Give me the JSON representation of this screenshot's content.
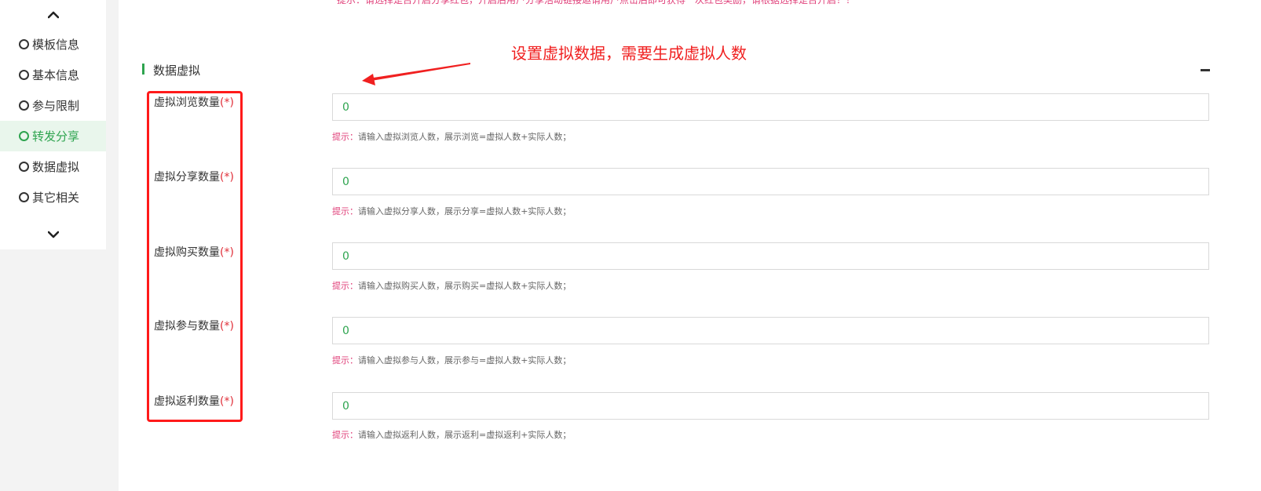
{
  "sidebar": {
    "items": [
      {
        "label": "模板信息",
        "active": false
      },
      {
        "label": "基本信息",
        "active": false
      },
      {
        "label": "参与限制",
        "active": false
      },
      {
        "label": "转发分享",
        "active": true
      },
      {
        "label": "数据虚拟",
        "active": false
      },
      {
        "label": "其它相关",
        "active": false
      }
    ],
    "up_icon": "chevron-up-icon",
    "down_icon": "chevron-down-icon"
  },
  "main": {
    "top_hint": "提示：请选择是否开启分享红包，开启后用户分享活动链接邀请用户点击后即可获得一次红包奖励，请根据选择是否开启！！",
    "annotation": "设置虚拟数据，需要生成虚拟人数",
    "section": {
      "title": "数据虚拟",
      "collapse_icon": "minus-icon"
    },
    "required_mark": "(*)",
    "hint_key": "提示：",
    "fields": [
      {
        "label": "虚拟浏览数量",
        "value": "0",
        "hint": "请输入虚拟浏览人数，展示浏览=虚拟人数+实际人数；"
      },
      {
        "label": "虚拟分享数量",
        "value": "0",
        "hint": "请输入虚拟分享人数，展示分享=虚拟人数+实际人数；"
      },
      {
        "label": "虚拟购买数量",
        "value": "0",
        "hint": "请输入虚拟购买人数，展示购买=虚拟人数+实际人数；"
      },
      {
        "label": "虚拟参与数量",
        "value": "0",
        "hint": "请输入虚拟参与人数，展示参与=虚拟人数+实际人数；"
      },
      {
        "label": "虚拟返利数量",
        "value": "0",
        "hint": "请输入虚拟返利人数，展示返利=虚拟返利+实际人数；"
      }
    ]
  },
  "colors": {
    "accent_green": "#2ea44f",
    "annotation_red": "#f02020",
    "hint_pink": "#e0407a"
  }
}
